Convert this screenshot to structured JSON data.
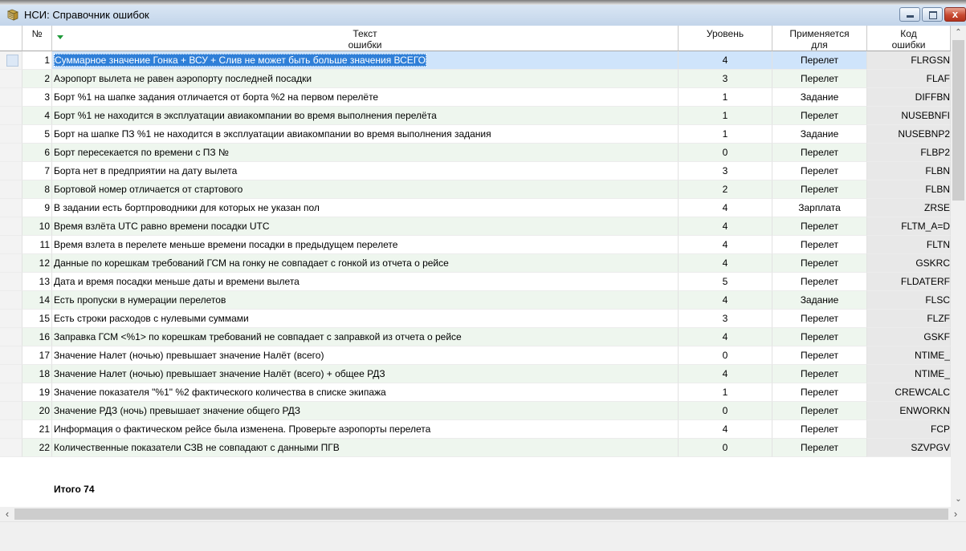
{
  "window": {
    "title": "НСИ: Справочник ошибок",
    "close_glyph": "x"
  },
  "columns": {
    "num": "№",
    "text_l1": "Текст",
    "text_l2": "ошибки",
    "level": "Уровень",
    "applies_l1": "Применяется",
    "applies_l2": "для",
    "code_l1": "Код",
    "code_l2": "ошибки"
  },
  "rows": [
    {
      "n": "1",
      "text": "Суммарное значение Гонка + ВСУ + Слив не может быть больше значения ВСЕГО",
      "level": "4",
      "applies": "Перелет",
      "code": "FLRGSN"
    },
    {
      "n": "2",
      "text": "Аэропорт вылета не равен аэропорту последней посадки",
      "level": "3",
      "applies": "Перелет",
      "code": "FLAF"
    },
    {
      "n": "3",
      "text": "Борт %1 на шапке задания отличается от борта %2 на первом перелёте",
      "level": "1",
      "applies": "Задание",
      "code": "DIFFBN"
    },
    {
      "n": "4",
      "text": "Борт %1 не находится в эксплуатации авиакомпании во время выполнения перелёта",
      "level": "1",
      "applies": "Перелет",
      "code": "NUSEBNFI"
    },
    {
      "n": "5",
      "text": "Борт на шапке ПЗ %1 не находится в эксплуатации авиакомпании во время выполнения задания",
      "level": "1",
      "applies": "Задание",
      "code": "NUSEBNP2"
    },
    {
      "n": "6",
      "text": "Борт пересекается по времени с ПЗ №",
      "level": "0",
      "applies": "Перелет",
      "code": "FLBP2"
    },
    {
      "n": "7",
      "text": "Борта нет в предприятии на дату вылета",
      "level": "3",
      "applies": "Перелет",
      "code": "FLBN"
    },
    {
      "n": "8",
      "text": "Бортовой номер отличается от стартового",
      "level": "2",
      "applies": "Перелет",
      "code": "FLBN"
    },
    {
      "n": "9",
      "text": "В задании есть бортпроводники для которых не указан пол",
      "level": "4",
      "applies": "Зарплата",
      "code": "ZRSE"
    },
    {
      "n": "10",
      "text": "Время взлёта UTC равно времени посадки UTC",
      "level": "4",
      "applies": "Перелет",
      "code": "FLTM_A=D"
    },
    {
      "n": "11",
      "text": "Время взлета в перелете меньше времени посадки в предыдущем перелете",
      "level": "4",
      "applies": "Перелет",
      "code": "FLTN"
    },
    {
      "n": "12",
      "text": "Данные по корешкам требований ГСМ на гонку не совпадает с гонкой из отчета о рейсе",
      "level": "4",
      "applies": "Перелет",
      "code": "GSKRC"
    },
    {
      "n": "13",
      "text": "Дата и время посадки меньше даты и времени вылета",
      "level": "5",
      "applies": "Перелет",
      "code": "FLDATERF"
    },
    {
      "n": "14",
      "text": "Есть пропуски в нумерации перелетов",
      "level": "4",
      "applies": "Задание",
      "code": "FLSC"
    },
    {
      "n": "15",
      "text": "Есть строки расходов с нулевыми суммами",
      "level": "3",
      "applies": "Перелет",
      "code": "FLZF"
    },
    {
      "n": "16",
      "text": "Заправка ГСМ <%1> по корешкам требований не совпадает с заправкой из отчета о рейсе",
      "level": "4",
      "applies": "Перелет",
      "code": "GSKF"
    },
    {
      "n": "17",
      "text": "Значение Налет (ночью) превышает значение Налёт (всего)",
      "level": "0",
      "applies": "Перелет",
      "code": "NTIME_"
    },
    {
      "n": "18",
      "text": "Значение Налет (ночью) превышает значение Налёт (всего) + общее РДЗ",
      "level": "4",
      "applies": "Перелет",
      "code": "NTIME_"
    },
    {
      "n": "19",
      "text": "Значение показателя \"%1\" %2 фактического количества в списке экипажа",
      "level": "1",
      "applies": "Перелет",
      "code": "CREWCALC"
    },
    {
      "n": "20",
      "text": "Значение РДЗ (ночь) превышает значение общего РДЗ",
      "level": "0",
      "applies": "Перелет",
      "code": "ENWORKN"
    },
    {
      "n": "21",
      "text": "Информация о фактическом рейсе была изменена. Проверьте аэропорты перелета",
      "level": "4",
      "applies": "Перелет",
      "code": "FCP"
    },
    {
      "n": "22",
      "text": "Количественные показатели СЗВ не совпадают с данными ПГВ",
      "level": "0",
      "applies": "Перелет",
      "code": "SZVPGV"
    }
  ],
  "selected_row": 1,
  "footer": {
    "total": "Итого 74"
  },
  "scroll": {
    "up": "⌃",
    "down": "⌄",
    "left": "‹",
    "right": "›"
  },
  "colors": {
    "selection": "#2f7fd8",
    "selected_row_bg": "#cfe4fb",
    "alt_row_bg": "#eef6ee",
    "sort_arrow": "#1f9a3a"
  }
}
